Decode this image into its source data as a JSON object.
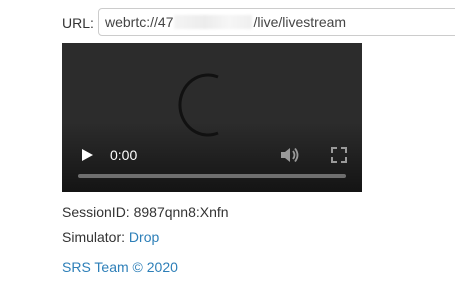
{
  "url_field": {
    "label": "URL:",
    "value_prefix": "webrtc://47",
    "value_suffix": "/live/livestream"
  },
  "player": {
    "time": "0:00",
    "progress": 0,
    "state": "loading",
    "icons": {
      "play": "play-icon",
      "volume": "volume-icon",
      "fullscreen": "fullscreen-icon",
      "spinner": "loading-spinner-icon"
    }
  },
  "session": {
    "label": "SessionID:",
    "value": "8987qnn8:Xnfn"
  },
  "simulator": {
    "label": "Simulator:",
    "link": "Drop"
  },
  "footer": {
    "text": "SRS Team © 2020"
  },
  "colors": {
    "link": "#2d7fb8",
    "video_bg": "#2c2c2c",
    "text": "#333333"
  }
}
